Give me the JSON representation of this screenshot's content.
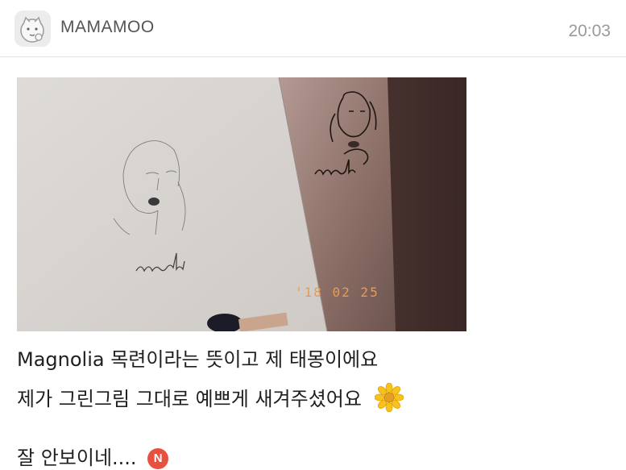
{
  "header": {
    "name": "MAMAMOO",
    "time": "20:03",
    "avatar_icon": "cartoon-face-avatar-icon"
  },
  "post": {
    "photo": {
      "sketch_caption": "magnolia",
      "tattoo_caption": "magnolia",
      "date_stamp": "'18 02 25"
    },
    "lines": [
      "Magnolia 목련이라는 뜻이고 제 태몽이에요",
      "제가 그린그림 그대로 예쁘게 새겨주셨어요",
      "잘 안보이네...."
    ],
    "flower_icon": "sunflower-emoji-icon",
    "new_badge": "N"
  },
  "colors": {
    "badge": "#e8513d",
    "text": "#1f1f1f",
    "time": "#9a9a9a"
  }
}
